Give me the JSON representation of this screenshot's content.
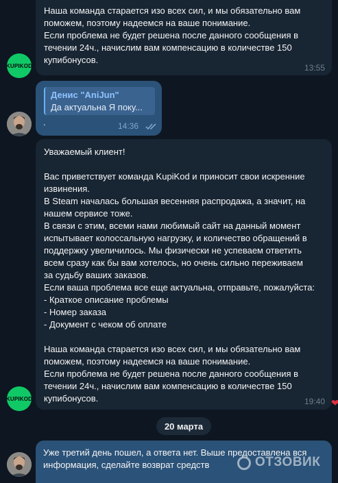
{
  "messages": [
    {
      "text": "Наша команда старается изо всех сил, и мы обязательно вам\nпоможем, поэтому надеемся на ваше понимание.\nЕсли проблема не будет решена после данного сообщения в\nтечении 24ч., начислим вам компенсацию в количестве 150\nкупибонусов.",
      "time": "13:55"
    },
    {
      "reply_name": "Денис \"AniJun\"",
      "reply_text": "Да актуальна  Я поку...",
      "text": ".",
      "time": "14:36"
    },
    {
      "text": "Уважаемый клиент!\n\nВас приветствует команда KupiKod и приносит свои искренние\nизвинения.\nВ Steam началась большая весенняя распродажа, а значит, на\nнашем сервисе тоже.\nВ связи с этим, всеми нами любимый сайт на данный момент\nиспытывает колоссальную нагрузку, и количество обращений в\nподдержку увеличилось. Мы физически не успеваем ответить\nвсем сразу как бы вам хотелось, но очень сильно переживаем\nза судьбу ваших заказов.\nЕсли ваша проблема все еще актуальна, отправьте, пожалуйста:\n- Краткое описание проблемы\n- Номер заказа\n- Документ с чеком об оплате\n\nНаша команда старается изо всех сил, и мы обязательно вам\nпоможем, поэтому надеемся на ваше понимание.\nЕсли проблема не будет решена после данного сообщения в\nтечении 24ч., начислим вам компенсацию в количестве 150\nкупибонусов.",
      "time": "19:40"
    },
    {
      "text": "Уже третий день пошел, а ответа нет. Выше предоставлена вся\nинформация, сделайте возврат средств"
    }
  ],
  "date_divider": "20 марта",
  "avatar_logo_text": "KUPIKOD",
  "watermark": "ОТЗОВИК",
  "colors": {
    "background": "#0e1621",
    "incoming_bubble": "#182533",
    "outgoing_bubble": "#2b5278",
    "accent": "#6ab3f3",
    "logo_green": "#10c966"
  }
}
